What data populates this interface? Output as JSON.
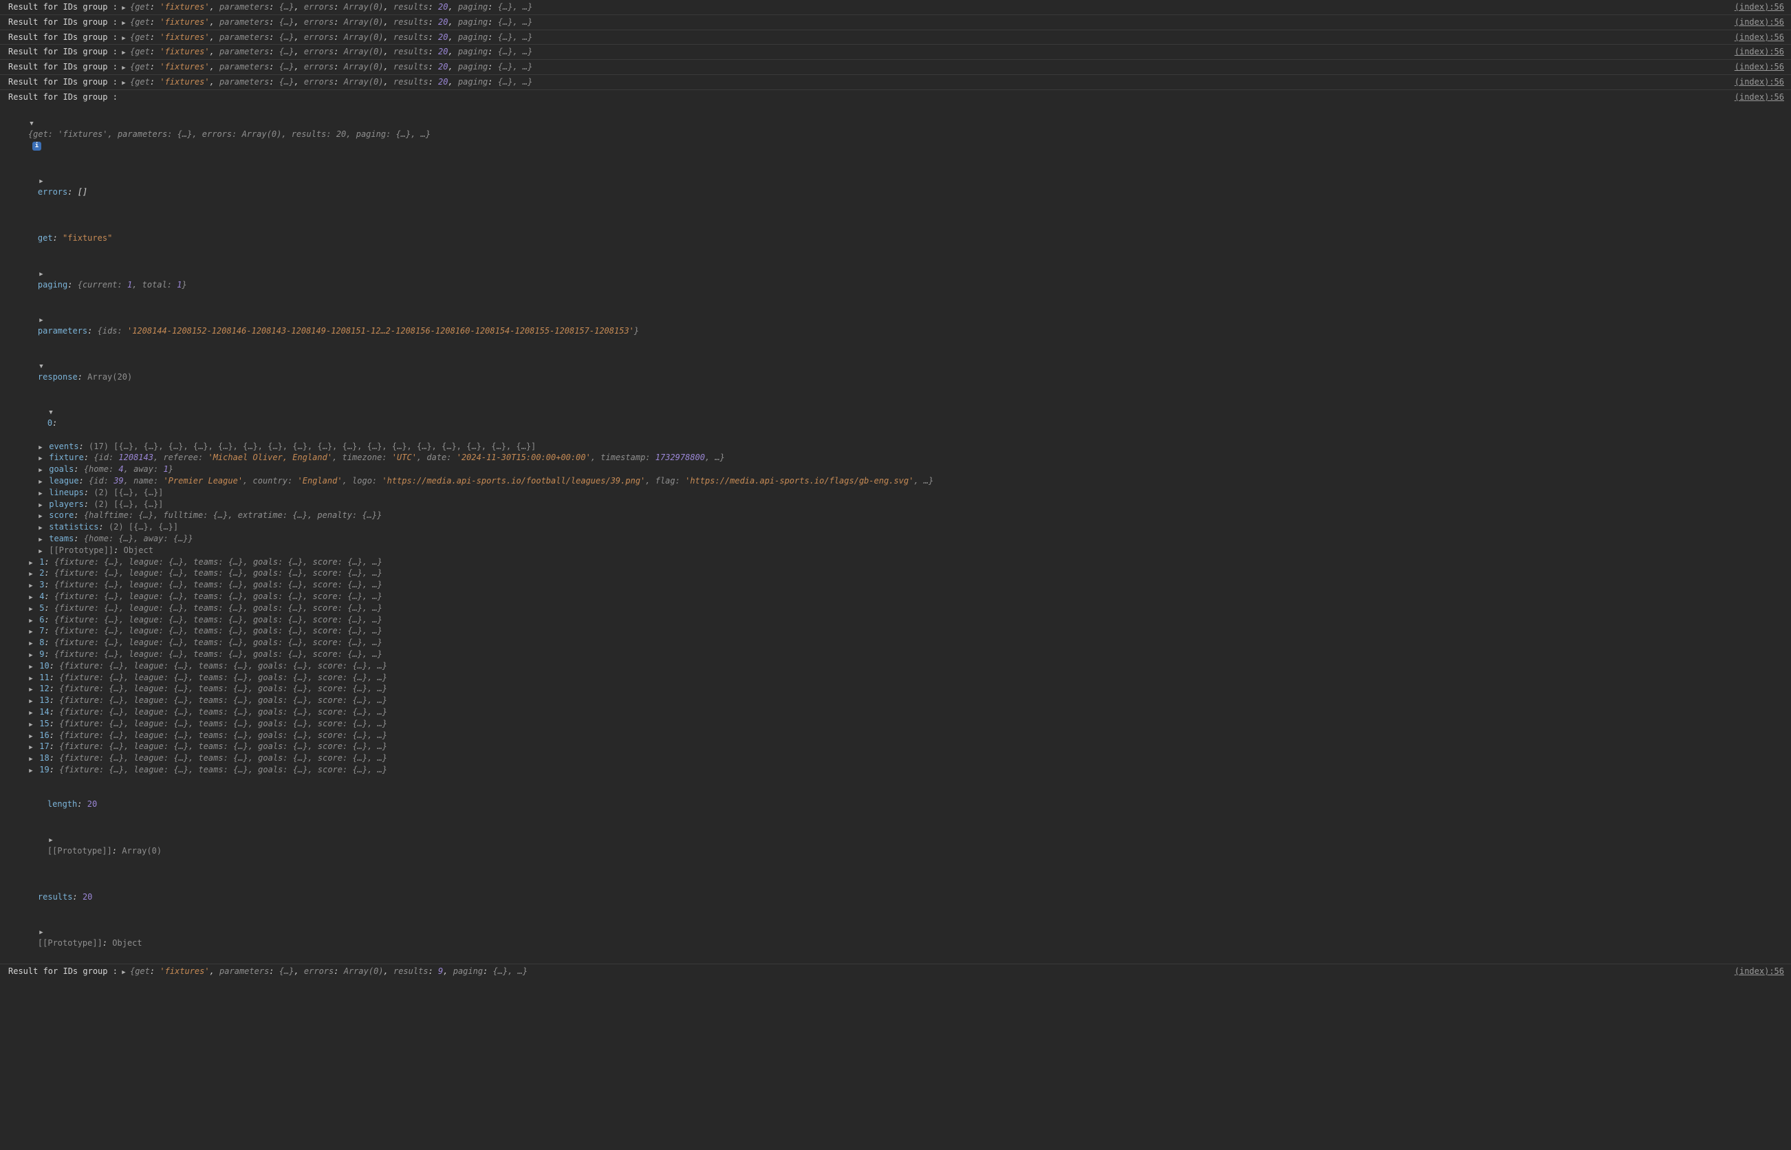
{
  "source_link": "(index):56",
  "log_prefix": "Result for IDs group :",
  "collapsed_summary_20": "{get: 'fixtures', parameters: {…}, errors: Array(0), results: 20, paging: {…}, …}",
  "collapsed_summary_9": "{get: 'fixtures', parameters: {…}, errors: Array(0), results: 9, paging: {…}, …}",
  "expanded": {
    "header_summary": "{get: 'fixtures', parameters: {…}, errors: Array(0), results: 20, paging: {…}, …}",
    "errors_label": "errors",
    "errors_val": "[]",
    "get_label": "get",
    "get_val": "\"fixtures\"",
    "paging_label": "paging",
    "paging_val": "{current: 1, total: 1}",
    "parameters_label": "parameters",
    "parameters_val": "{ids: '1208144-1208152-1208146-1208143-1208149-1208151-12…2-1208156-1208160-1208154-1208155-1208157-1208153'}",
    "response_label": "response",
    "response_val": "Array(20)",
    "item0_label": "0",
    "item0": {
      "events": "(17) [{…}, {…}, {…}, {…}, {…}, {…}, {…}, {…}, {…}, {…}, {…}, {…}, {…}, {…}, {…}, {…}, {…}]",
      "fixture": "{id: 1208143, referee: 'Michael Oliver, England', timezone: 'UTC', date: '2024-11-30T15:00:00+00:00', timestamp: 1732978800, …}",
      "goals": "{home: 4, away: 1}",
      "league": "{id: 39, name: 'Premier League', country: 'England', logo: 'https://media.api-sports.io/football/leagues/39.png', flag: 'https://media.api-sports.io/flags/gb-eng.svg', …}",
      "lineups": "(2) [{…}, {…}]",
      "players": "(2) [{…}, {…}]",
      "score": "{halftime: {…}, fulltime: {…}, extratime: {…}, penalty: {…}}",
      "statistics": "(2) [{…}, {…}]",
      "teams": "{home: {…}, away: {…}}",
      "proto": "Object"
    },
    "collapsed_item": "{fixture: {…}, league: {…}, teams: {…}, goals: {…}, score: {…}, …}",
    "length_label": "length",
    "length_val": "20",
    "proto_arr": "Array(0)",
    "results_label": "results",
    "results_val": "20",
    "proto_obj": "Object",
    "proto_label": "[[Prototype]]"
  },
  "item0_keys": {
    "events": "events",
    "fixture": "fixture",
    "goals": "goals",
    "league": "league",
    "lineups": "lineups",
    "players": "players",
    "score": "score",
    "statistics": "statistics",
    "teams": "teams"
  },
  "indices": [
    "1",
    "2",
    "3",
    "4",
    "5",
    "6",
    "7",
    "8",
    "9",
    "10",
    "11",
    "12",
    "13",
    "14",
    "15",
    "16",
    "17",
    "18",
    "19"
  ]
}
